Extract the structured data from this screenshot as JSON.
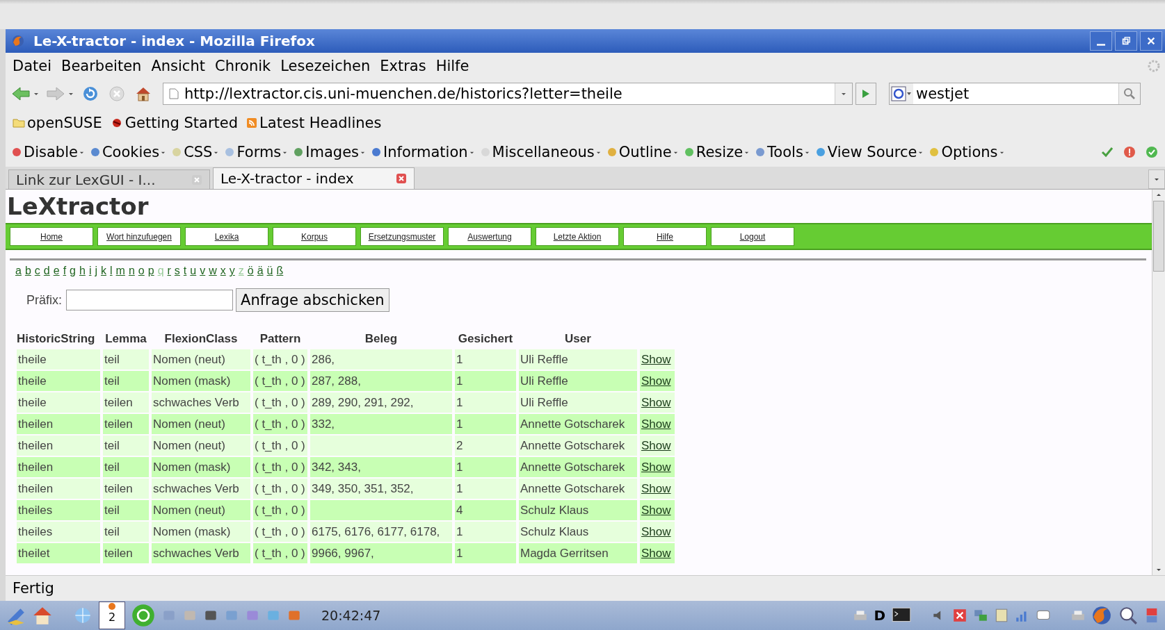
{
  "window": {
    "title": "Le-X-tractor - index - Mozilla Firefox"
  },
  "menu": [
    "Datei",
    "Bearbeiten",
    "Ansicht",
    "Chronik",
    "Lesezeichen",
    "Extras",
    "Hilfe"
  ],
  "address": {
    "value": "http://lextractor.cis.uni-muenchen.de/historics?letter=theile"
  },
  "search": {
    "value": "westjet"
  },
  "bookmarks": [
    {
      "label": "openSUSE",
      "kind": "folder"
    },
    {
      "label": "Getting Started",
      "kind": "page"
    },
    {
      "label": "Latest Headlines",
      "kind": "feed"
    }
  ],
  "devtoolbar": [
    "Disable",
    "Cookies",
    "CSS",
    "Forms",
    "Images",
    "Information",
    "Miscellaneous",
    "Outline",
    "Resize",
    "Tools",
    "View Source",
    "Options"
  ],
  "tabs": [
    {
      "label": "Link zur LexGUI - I...",
      "selected": false
    },
    {
      "label": "Le-X-tractor - index",
      "selected": true
    }
  ],
  "page": {
    "title": "LeXtractor",
    "nav": [
      "Home",
      "Wort hinzufuegen",
      "Lexika",
      "Korpus",
      "Ersetzungsmuster",
      "Auswertung",
      "Letzte Aktion",
      "Hilfe",
      "Logout"
    ],
    "letters": [
      {
        "label": "a",
        "dimmed": false
      },
      {
        "label": "b",
        "dimmed": false
      },
      {
        "label": "c",
        "dimmed": false
      },
      {
        "label": "d",
        "dimmed": false
      },
      {
        "label": "e",
        "dimmed": false
      },
      {
        "label": "f",
        "dimmed": false
      },
      {
        "label": "g",
        "dimmed": false
      },
      {
        "label": "h",
        "dimmed": false
      },
      {
        "label": "i",
        "dimmed": false
      },
      {
        "label": "j",
        "dimmed": false
      },
      {
        "label": "k",
        "dimmed": false
      },
      {
        "label": "l",
        "dimmed": false
      },
      {
        "label": "m",
        "dimmed": false
      },
      {
        "label": "n",
        "dimmed": false
      },
      {
        "label": "o",
        "dimmed": false
      },
      {
        "label": "p",
        "dimmed": false
      },
      {
        "label": "q",
        "dimmed": true
      },
      {
        "label": "r",
        "dimmed": false
      },
      {
        "label": "s",
        "dimmed": false
      },
      {
        "label": "t",
        "dimmed": false
      },
      {
        "label": "u",
        "dimmed": false
      },
      {
        "label": "v",
        "dimmed": false
      },
      {
        "label": "w",
        "dimmed": false
      },
      {
        "label": "x",
        "dimmed": false
      },
      {
        "label": "y",
        "dimmed": false
      },
      {
        "label": "z",
        "dimmed": true
      },
      {
        "label": "ö",
        "dimmed": false
      },
      {
        "label": "ä",
        "dimmed": false
      },
      {
        "label": "ü",
        "dimmed": false
      },
      {
        "label": "ß",
        "dimmed": false
      }
    ],
    "prefix_label": "Präfix:",
    "submit": "Anfrage abschicken",
    "table": {
      "columns": [
        "HistoricString",
        "Lemma",
        "FlexionClass",
        "Pattern",
        "Beleg",
        "Gesichert",
        "User"
      ],
      "rows": [
        [
          "theile",
          "teil",
          "Nomen (neut)",
          "( t_th , 0 )",
          "286,",
          "1",
          "Uli Reffle",
          "Show"
        ],
        [
          "theile",
          "teil",
          "Nomen (mask)",
          "( t_th , 0 )",
          "287, 288,",
          "1",
          "Uli Reffle",
          "Show"
        ],
        [
          "theile",
          "teilen",
          "schwaches Verb",
          "( t_th , 0 )",
          "289, 290, 291, 292,",
          "1",
          "Uli Reffle",
          "Show"
        ],
        [
          "theilen",
          "teilen",
          "Nomen (neut)",
          "( t_th , 0 )",
          "332,",
          "1",
          "Annette Gotscharek",
          "Show"
        ],
        [
          "theilen",
          "teil",
          "Nomen (neut)",
          "( t_th , 0 )",
          "",
          "2",
          "Annette Gotscharek",
          "Show"
        ],
        [
          "theilen",
          "teil",
          "Nomen (mask)",
          "( t_th , 0 )",
          "342, 343,",
          "1",
          "Annette Gotscharek",
          "Show"
        ],
        [
          "theilen",
          "teilen",
          "schwaches Verb",
          "( t_th , 0 )",
          "349, 350, 351, 352,",
          "1",
          "Annette Gotscharek",
          "Show"
        ],
        [
          "theiles",
          "teil",
          "Nomen (neut)",
          "( t_th , 0 )",
          "",
          "4",
          "Schulz Klaus",
          "Show"
        ],
        [
          "theiles",
          "teil",
          "Nomen (mask)",
          "( t_th , 0 )",
          "6175, 6176, 6177, 6178,",
          "1",
          "Schulz Klaus",
          "Show"
        ],
        [
          "theilet",
          "teilen",
          "schwaches Verb",
          "( t_th , 0 )",
          "9966, 9967,",
          "1",
          "Magda Gerritsen",
          "Show"
        ]
      ]
    }
  },
  "status_bar": "Fertig",
  "taskbar": {
    "pager": "2",
    "clock": "20:42:47",
    "tray_letter": "D"
  }
}
